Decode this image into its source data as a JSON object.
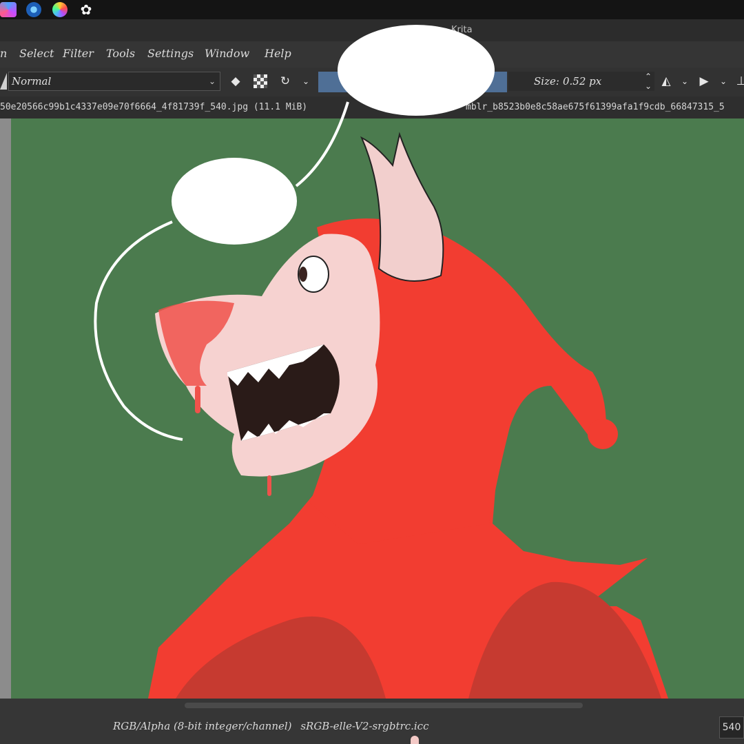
{
  "taskbar": {
    "icons": [
      "krita-icon",
      "browser-icon",
      "color-wheel-icon",
      "settings-gear-icon"
    ]
  },
  "window": {
    "title": "Krita"
  },
  "menu": {
    "items": [
      "n",
      "Select",
      "Filter",
      "Tools",
      "Settings",
      "Window",
      "Help"
    ]
  },
  "toolbar": {
    "blend_mode": "Normal",
    "size_label": "Size:",
    "size_value": "0.52 px",
    "opacity_color": "#4f6f96"
  },
  "tabs": {
    "active": "50e20566c99b1c4337e09e70f6664_4f81739f_540.jpg (11.1 MiB)",
    "other": "mblr_b8523b0e8c58ae675f61399afa1f9cdb_66847315_5"
  },
  "status": {
    "color_model": "RGB/Alpha (8-bit integer/channel)",
    "profile": "sRGB-elle-V2-srgbtrc.icc",
    "zoom": "540"
  },
  "colors": {
    "canvas_bg": "#4b7b4e",
    "jester_red": "#f23d31",
    "skin": "#f6d2d0"
  }
}
